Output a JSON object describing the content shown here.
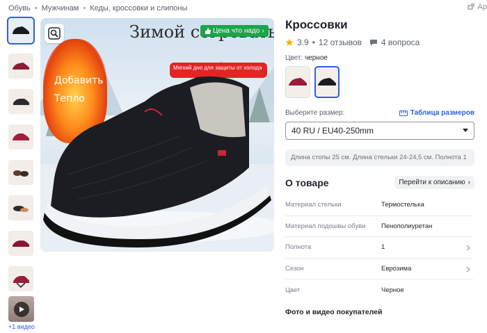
{
  "breadcrumbs": [
    "Обувь",
    "Мужчинам",
    "Кеды, кроссовки и слипоны"
  ],
  "top_right": "Ар",
  "gallery": {
    "thumb_count": 8,
    "video_label": "+1 видео"
  },
  "main_image": {
    "headline": "Зимой согревать",
    "badge": "Цена что надо",
    "note": "Мягкий дно для защиты от холода",
    "flame_lines": [
      "Добавить",
      "Тепло"
    ]
  },
  "product": {
    "title": "Кроссовки",
    "rating": "3.9",
    "reviews": "12 отзывов",
    "questions": "4 вопроса",
    "color_label": "Цвет:",
    "color_value": "черное",
    "size_label": "Выберите размер:",
    "size_table": "Таблица размеров",
    "size_selected": "40 RU / EU40-250mm",
    "size_hint": "Длина стопы 25 см. Длина стельки 24-24,5 см. Полнота 1"
  },
  "about": {
    "title": "О товаре",
    "goto": "Перейти к описанию",
    "specs": [
      {
        "k": "Материал стельки",
        "v": "Термостелька"
      },
      {
        "k": "Материал подошвы обуви",
        "v": "Пенополиуретан"
      },
      {
        "k": "Полнота",
        "v": "1"
      },
      {
        "k": "Сезон",
        "v": "Еврозима"
      },
      {
        "k": "Цвет",
        "v": "Черное"
      }
    ],
    "footer": "Фото и видео покупателей"
  },
  "colors": {
    "accent": "#2c5ee8",
    "badge_green": "#1aa54a",
    "note_red": "#e42424",
    "star": "#f7b500"
  }
}
